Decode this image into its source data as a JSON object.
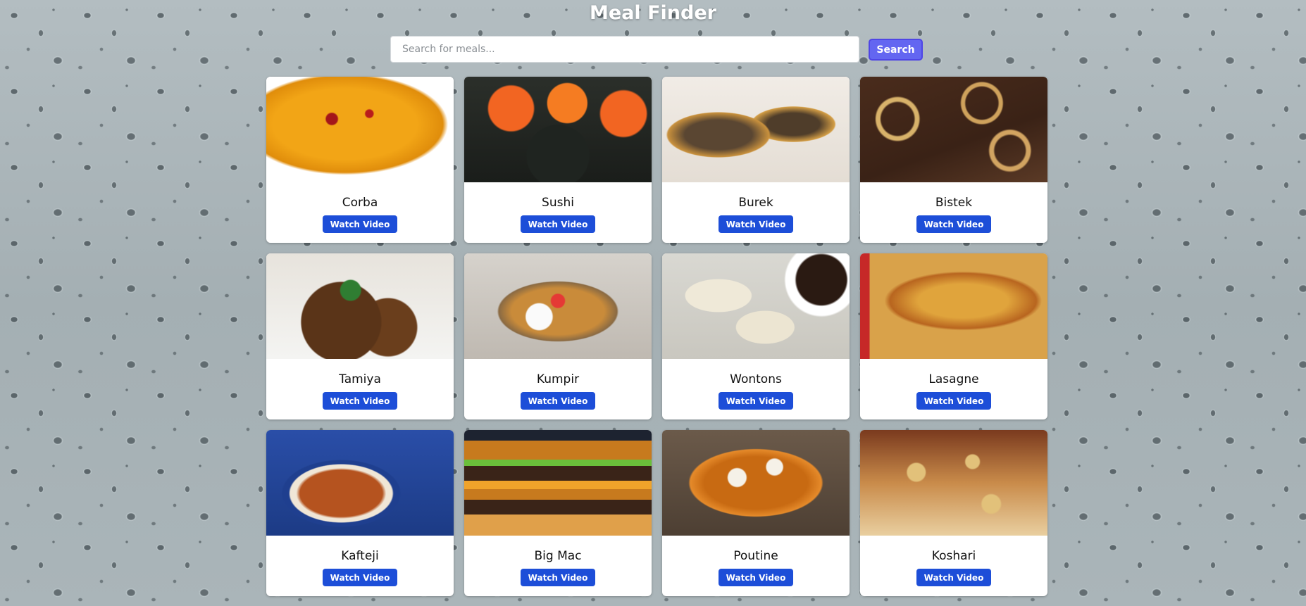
{
  "header": {
    "title": "Meal Finder"
  },
  "search": {
    "placeholder": "Search for meals...",
    "value": "",
    "button_label": "Search"
  },
  "meals": [
    {
      "name": "Corba",
      "button_label": "Watch Video"
    },
    {
      "name": "Sushi",
      "button_label": "Watch Video"
    },
    {
      "name": "Burek",
      "button_label": "Watch Video"
    },
    {
      "name": "Bistek",
      "button_label": "Watch Video"
    },
    {
      "name": "Tamiya",
      "button_label": "Watch Video"
    },
    {
      "name": "Kumpir",
      "button_label": "Watch Video"
    },
    {
      "name": "Wontons",
      "button_label": "Watch Video"
    },
    {
      "name": "Lasagne",
      "button_label": "Watch Video"
    },
    {
      "name": "Kafteji",
      "button_label": "Watch Video"
    },
    {
      "name": "Big Mac",
      "button_label": "Watch Video"
    },
    {
      "name": "Poutine",
      "button_label": "Watch Video"
    },
    {
      "name": "Koshari",
      "button_label": "Watch Video"
    }
  ],
  "colors": {
    "search_button": "#6366f1",
    "watch_button": "#1d4ed8",
    "card_background": "#ffffff",
    "title_text": "#ffffff"
  }
}
